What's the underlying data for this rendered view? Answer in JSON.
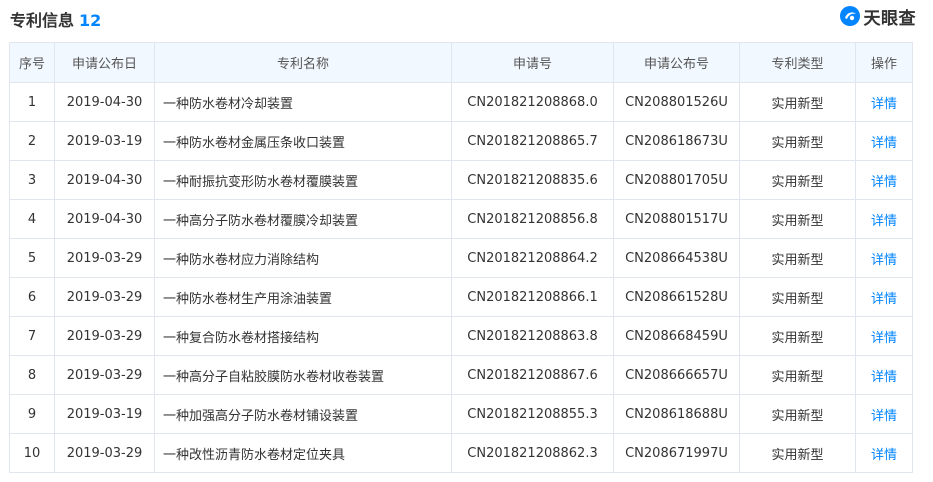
{
  "header": {
    "title": "专利信息",
    "count": "12",
    "brand_name": "天眼查",
    "brand_icon": "tianyancha-logo-icon",
    "accent_color": "#0084ff"
  },
  "table": {
    "columns": [
      "序号",
      "申请公布日",
      "专利名称",
      "申请号",
      "申请公布号",
      "专利类型",
      "操作"
    ],
    "rows": [
      {
        "no": "1",
        "date": "2019-04-30",
        "name": "一种防水卷材冷却装置",
        "app_no": "CN201821208868.0",
        "pub_no": "CN208801526U",
        "type": "实用新型",
        "action": "详情"
      },
      {
        "no": "2",
        "date": "2019-03-19",
        "name": "一种防水卷材金属压条收口装置",
        "app_no": "CN201821208865.7",
        "pub_no": "CN208618673U",
        "type": "实用新型",
        "action": "详情"
      },
      {
        "no": "3",
        "date": "2019-04-30",
        "name": "一种耐振抗变形防水卷材覆膜装置",
        "app_no": "CN201821208835.6",
        "pub_no": "CN208801705U",
        "type": "实用新型",
        "action": "详情"
      },
      {
        "no": "4",
        "date": "2019-04-30",
        "name": "一种高分子防水卷材覆膜冷却装置",
        "app_no": "CN201821208856.8",
        "pub_no": "CN208801517U",
        "type": "实用新型",
        "action": "详情"
      },
      {
        "no": "5",
        "date": "2019-03-29",
        "name": "一种防水卷材应力消除结构",
        "app_no": "CN201821208864.2",
        "pub_no": "CN208664538U",
        "type": "实用新型",
        "action": "详情"
      },
      {
        "no": "6",
        "date": "2019-03-29",
        "name": "一种防水卷材生产用涂油装置",
        "app_no": "CN201821208866.1",
        "pub_no": "CN208661528U",
        "type": "实用新型",
        "action": "详情"
      },
      {
        "no": "7",
        "date": "2019-03-29",
        "name": "一种复合防水卷材搭接结构",
        "app_no": "CN201821208863.8",
        "pub_no": "CN208668459U",
        "type": "实用新型",
        "action": "详情"
      },
      {
        "no": "8",
        "date": "2019-03-29",
        "name": "一种高分子自粘胶膜防水卷材收卷装置",
        "app_no": "CN201821208867.6",
        "pub_no": "CN208666657U",
        "type": "实用新型",
        "action": "详情"
      },
      {
        "no": "9",
        "date": "2019-03-19",
        "name": "一种加强高分子防水卷材铺设装置",
        "app_no": "CN201821208855.3",
        "pub_no": "CN208618688U",
        "type": "实用新型",
        "action": "详情"
      },
      {
        "no": "10",
        "date": "2019-03-29",
        "name": "一种改性沥青防水卷材定位夹具",
        "app_no": "CN201821208862.3",
        "pub_no": "CN208671997U",
        "type": "实用新型",
        "action": "详情"
      }
    ]
  }
}
